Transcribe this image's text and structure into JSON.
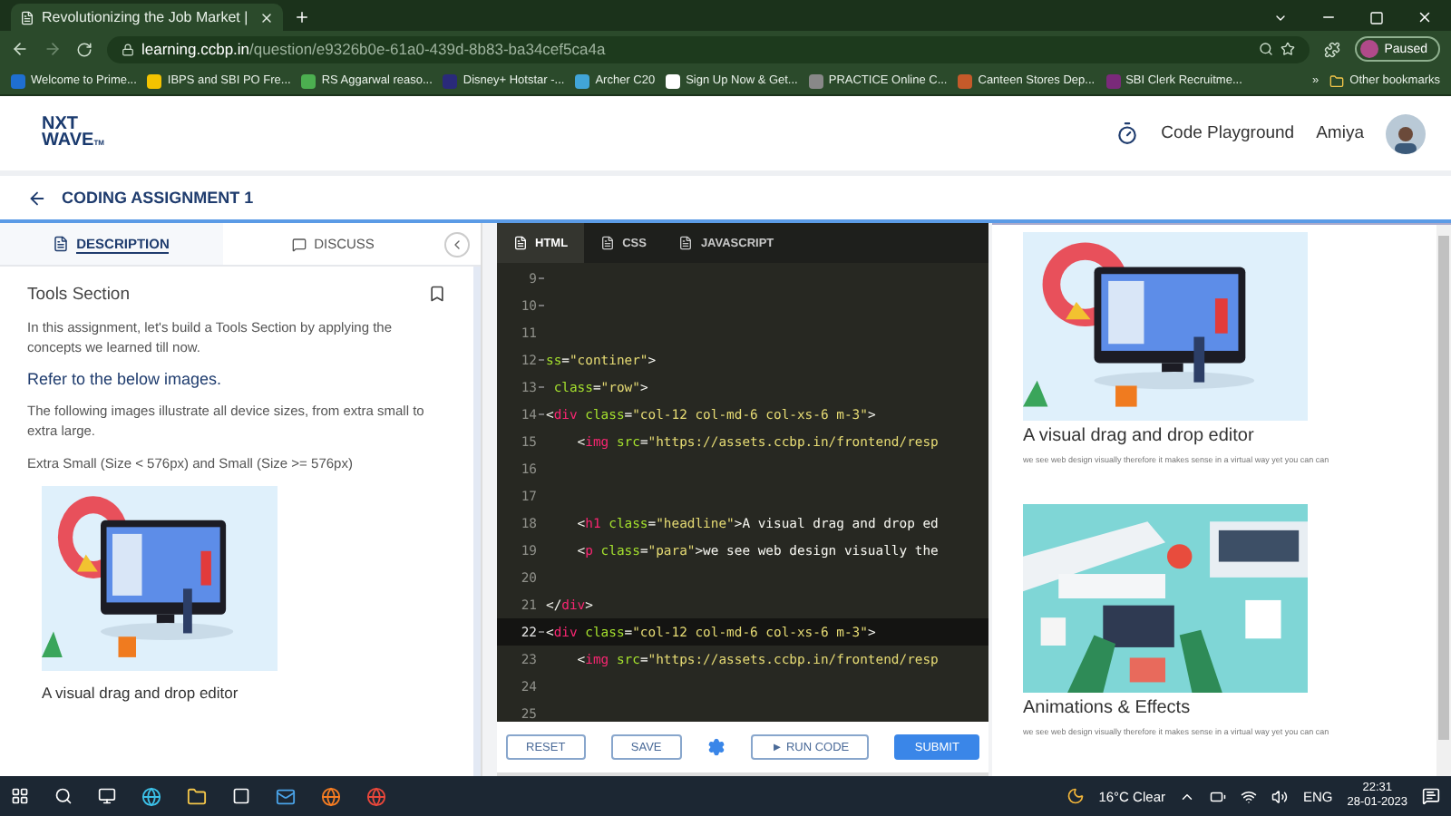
{
  "browser": {
    "tab_title": "Revolutionizing the Job Market |",
    "url_host": "learning.ccbp.in",
    "url_path": "/question/e9326b0e-61a0-439d-8b83-ba34cef5ca4a",
    "profile": "Paused",
    "bookmarks": [
      "Welcome to Prime...",
      "IBPS and SBI PO Fre...",
      "RS Aggarwal reaso...",
      "Disney+ Hotstar -...",
      "Archer C20",
      "Sign Up Now & Get...",
      "PRACTICE Online C...",
      "Canteen Stores Dep...",
      "SBI Clerk Recruitme..."
    ],
    "more": "»",
    "other_bookmarks": "Other bookmarks"
  },
  "header": {
    "logo_top": "NXT",
    "logo_bottom": "WAVE",
    "logo_mark": "TM",
    "playground": "Code Playground",
    "user": "Amiya"
  },
  "assignment": {
    "title": "CODING ASSIGNMENT 1"
  },
  "left_tabs": [
    {
      "label": "DESCRIPTION",
      "selected": true
    },
    {
      "label": "DISCUSS",
      "selected": false
    }
  ],
  "description": {
    "heading": "Tools Section",
    "intro": "In this assignment, let's build a Tools Section by applying the concepts we learned till now.",
    "subheading": "Refer to the below images.",
    "body": "The following images illustrate all device sizes, from extra small to extra large.",
    "sizes": "Extra Small (Size < 576px) and Small (Size >= 576px)",
    "caption": "A visual drag and drop editor"
  },
  "editor_tabs": [
    {
      "label": "HTML",
      "selected": true
    },
    {
      "label": "CSS",
      "selected": false
    },
    {
      "label": "JAVASCRIPT",
      "selected": false
    }
  ],
  "code_lines": [
    {
      "number": "9",
      "fold": true,
      "selected": false
    },
    {
      "number": "10",
      "fold": true,
      "selected": false
    },
    {
      "number": "11",
      "fold": false,
      "selected": false
    },
    {
      "number": "12",
      "fold": true,
      "selected": false,
      "segments": [
        {
          "kind": "attr",
          "text": "ss"
        },
        {
          "kind": "plain",
          "text": "="
        },
        {
          "kind": "string",
          "text": "\"continer\""
        },
        {
          "kind": "plain",
          "text": ">"
        }
      ]
    },
    {
      "number": "13",
      "fold": true,
      "selected": false,
      "segments": [
        {
          "kind": "attr",
          "text": " class"
        },
        {
          "kind": "plain",
          "text": "="
        },
        {
          "kind": "string",
          "text": "\"row\""
        },
        {
          "kind": "plain",
          "text": ">"
        }
      ]
    },
    {
      "number": "14",
      "fold": true,
      "selected": false,
      "segments": [
        {
          "kind": "plain",
          "text": "<"
        },
        {
          "kind": "tag",
          "text": "div"
        },
        {
          "kind": "attr",
          "text": " class"
        },
        {
          "kind": "plain",
          "text": "="
        },
        {
          "kind": "string",
          "text": "\"col-12 col-md-6 col-xs-6 m-3\""
        },
        {
          "kind": "plain",
          "text": ">"
        }
      ]
    },
    {
      "number": "15",
      "fold": false,
      "selected": false,
      "segments": [
        {
          "kind": "plain",
          "text": "    <"
        },
        {
          "kind": "tag",
          "text": "img"
        },
        {
          "kind": "attr",
          "text": " src"
        },
        {
          "kind": "plain",
          "text": "="
        },
        {
          "kind": "string",
          "text": "\"https://assets.ccbp.in/frontend/resp"
        }
      ]
    },
    {
      "number": "16",
      "fold": false,
      "selected": false
    },
    {
      "number": "17",
      "fold": false,
      "selected": false
    },
    {
      "number": "18",
      "fold": false,
      "selected": false,
      "segments": [
        {
          "kind": "plain",
          "text": "    <"
        },
        {
          "kind": "tag",
          "text": "h1"
        },
        {
          "kind": "attr",
          "text": " class"
        },
        {
          "kind": "plain",
          "text": "="
        },
        {
          "kind": "string",
          "text": "\"headline\""
        },
        {
          "kind": "plain",
          "text": ">A visual drag and drop ed"
        }
      ]
    },
    {
      "number": "19",
      "fold": false,
      "selected": false,
      "segments": [
        {
          "kind": "plain",
          "text": "    <"
        },
        {
          "kind": "tag",
          "text": "p"
        },
        {
          "kind": "attr",
          "text": " class"
        },
        {
          "kind": "plain",
          "text": "="
        },
        {
          "kind": "string",
          "text": "\"para\""
        },
        {
          "kind": "plain",
          "text": ">we see web design visually the"
        }
      ]
    },
    {
      "number": "20",
      "fold": false,
      "selected": false
    },
    {
      "number": "21",
      "fold": false,
      "selected": false,
      "segments": [
        {
          "kind": "plain",
          "text": "</"
        },
        {
          "kind": "tag",
          "text": "div"
        },
        {
          "kind": "plain",
          "text": ">"
        }
      ]
    },
    {
      "number": "22",
      "fold": true,
      "selected": true,
      "segments": [
        {
          "kind": "plain",
          "text": "<"
        },
        {
          "kind": "tag",
          "text": "div"
        },
        {
          "kind": "attr",
          "text": " class"
        },
        {
          "kind": "plain",
          "text": "="
        },
        {
          "kind": "string",
          "text": "\"col-12 col-md-6 col-xs-6 m-3\""
        },
        {
          "kind": "plain",
          "text": ">"
        }
      ]
    },
    {
      "number": "23",
      "fold": false,
      "selected": false,
      "segments": [
        {
          "kind": "plain",
          "text": "    <"
        },
        {
          "kind": "tag",
          "text": "img"
        },
        {
          "kind": "attr",
          "text": " src"
        },
        {
          "kind": "plain",
          "text": "="
        },
        {
          "kind": "string",
          "text": "\"https://assets.ccbp.in/frontend/resp"
        }
      ]
    },
    {
      "number": "24",
      "fold": false,
      "selected": false
    },
    {
      "number": "25",
      "fold": false,
      "selected": false
    }
  ],
  "editor_buttons": [
    {
      "kind": "outline",
      "label": "RESET"
    },
    {
      "kind": "outline",
      "label": "SAVE"
    },
    {
      "kind": "gear"
    },
    {
      "kind": "run",
      "label": "► RUN CODE"
    },
    {
      "kind": "primary",
      "label": "SUBMIT"
    }
  ],
  "preview_cards": [
    {
      "kind": "editor",
      "title": "A visual drag and drop editor",
      "text": "we see web design visually therefore it makes sense in a virtual way yet you can can"
    },
    {
      "kind": "desk",
      "title": "Animations & Effects",
      "text": "we see web design visually therefore it makes sense in a virtual way yet you can can"
    }
  ],
  "taskbar": {
    "weather": "16°C  Clear",
    "language": "ENG",
    "time": "22:31",
    "date": "28-01-2023"
  }
}
